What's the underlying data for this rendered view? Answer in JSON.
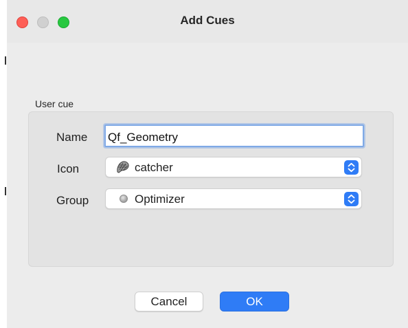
{
  "window": {
    "title": "Add Cues"
  },
  "group": {
    "label": "User cue"
  },
  "form": {
    "name_label": "Name",
    "name_value": "Qf_Geometry",
    "icon_label": "Icon",
    "icon_value": "catcher",
    "icon_symbol": "catcher-icon",
    "group_label": "Group",
    "group_value": "Optimizer",
    "group_symbol": "optimizer-icon"
  },
  "buttons": {
    "cancel": "Cancel",
    "ok": "OK"
  },
  "colors": {
    "accent": "#2f7cf6",
    "close": "#fe5f57",
    "maximize": "#28c840",
    "minimize": "#d0d0d0"
  }
}
